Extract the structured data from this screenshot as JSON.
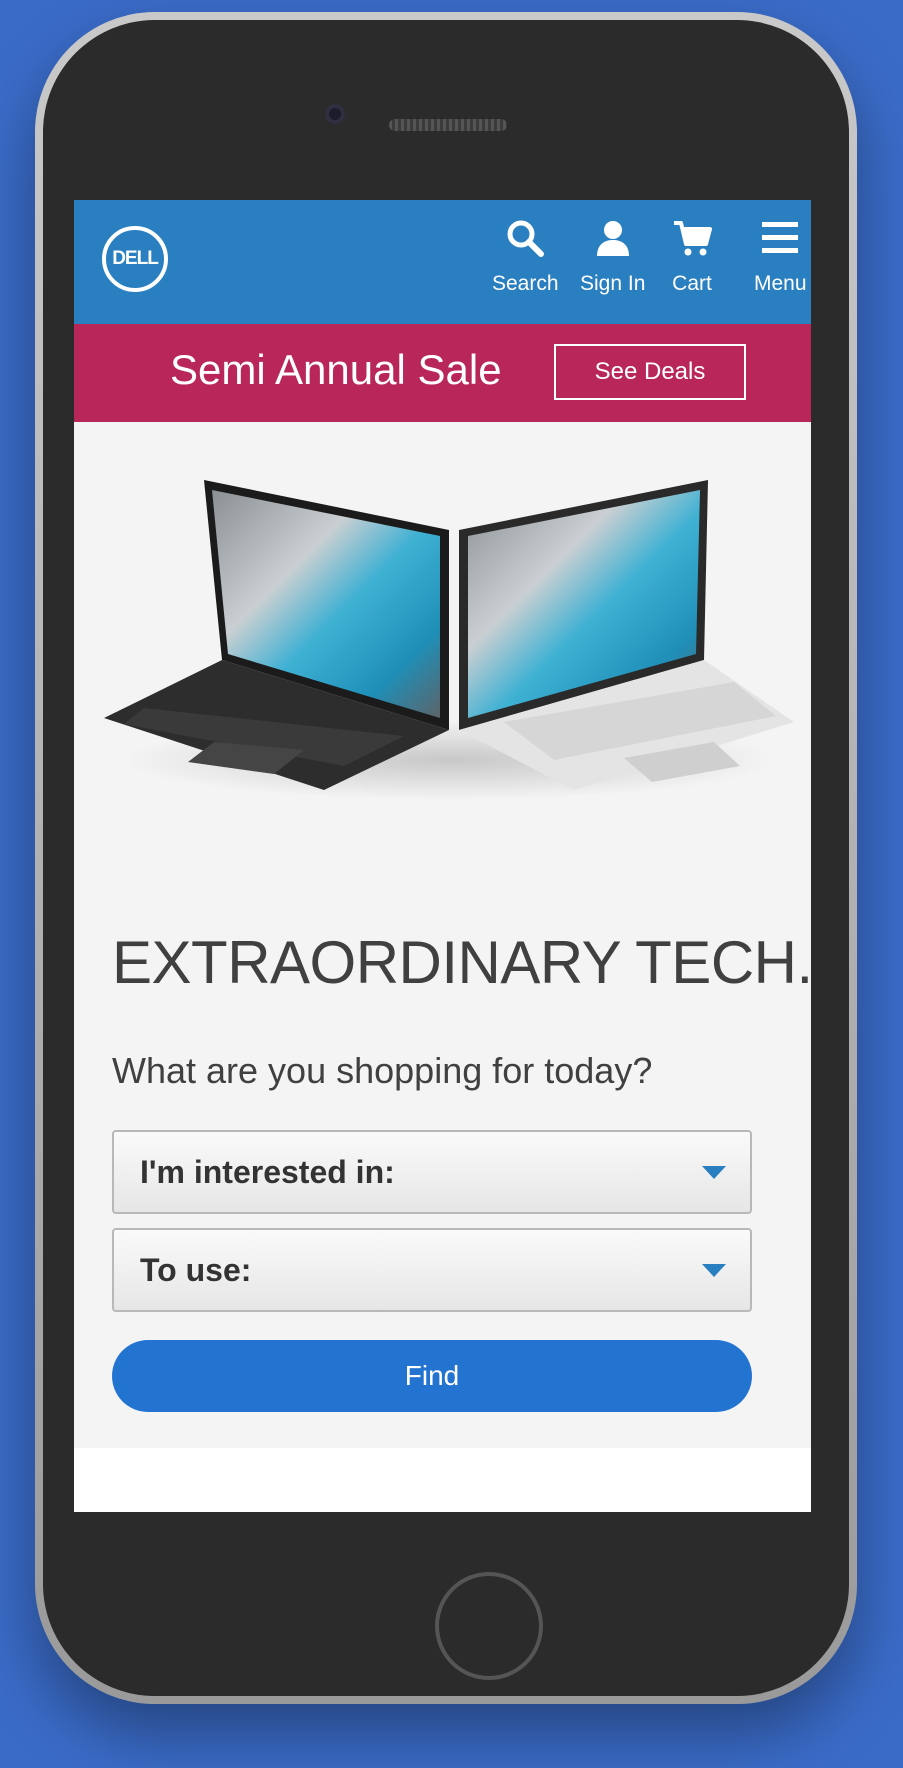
{
  "header": {
    "logo_text": "DELL",
    "nav": [
      {
        "label": "Search",
        "icon": "search-icon"
      },
      {
        "label": "Sign In",
        "icon": "user-icon"
      },
      {
        "label": "Cart",
        "icon": "cart-icon"
      },
      {
        "label": "Menu",
        "icon": "hamburger-menu-icon"
      }
    ]
  },
  "banner": {
    "title": "Semi Annual Sale",
    "button_label": "See Deals"
  },
  "main": {
    "headline": "EXTRAORDINARY TECH.",
    "subhead": "What are you shopping for today?",
    "select_interest": "I'm interested in:",
    "select_use": "To use:",
    "find_label": "Find"
  },
  "colors": {
    "header_bg": "#2a7fc0",
    "banner_bg": "#b8265a",
    "button_blue": "#2374d1"
  }
}
